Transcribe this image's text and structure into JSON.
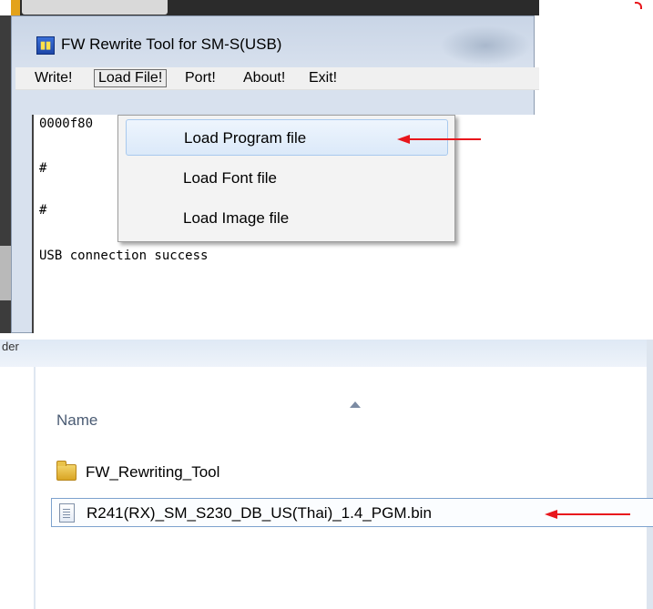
{
  "window": {
    "title": "FW Rewrite Tool for SM-S(USB)",
    "icon": "app-icon"
  },
  "menu": {
    "items": [
      "Write!",
      "Load File!",
      "Port!",
      "About!",
      "Exit!"
    ],
    "active": "Load File!"
  },
  "dropdown": {
    "items": [
      "Load Program file",
      "Load Font file",
      "Load Image file"
    ],
    "highlighted": "Load Program file"
  },
  "console": {
    "lines": [
      "0000f80",
      "#",
      "#",
      "USB connection success"
    ]
  },
  "explorer": {
    "nav_partial": "der",
    "column_header": "Name",
    "files": [
      {
        "name": "FW_Rewriting_Tool",
        "type": "folder-icon"
      },
      {
        "name": "R241(RX)_SM_S230_DB_US(Thai)_1.4_PGM.bin",
        "type": "file-icon",
        "selected": true
      }
    ]
  },
  "colors": {
    "annotation_arrow": "#e8161c",
    "menu_highlight": "#dbe9f9",
    "title_bar": "#d8e1ee"
  }
}
